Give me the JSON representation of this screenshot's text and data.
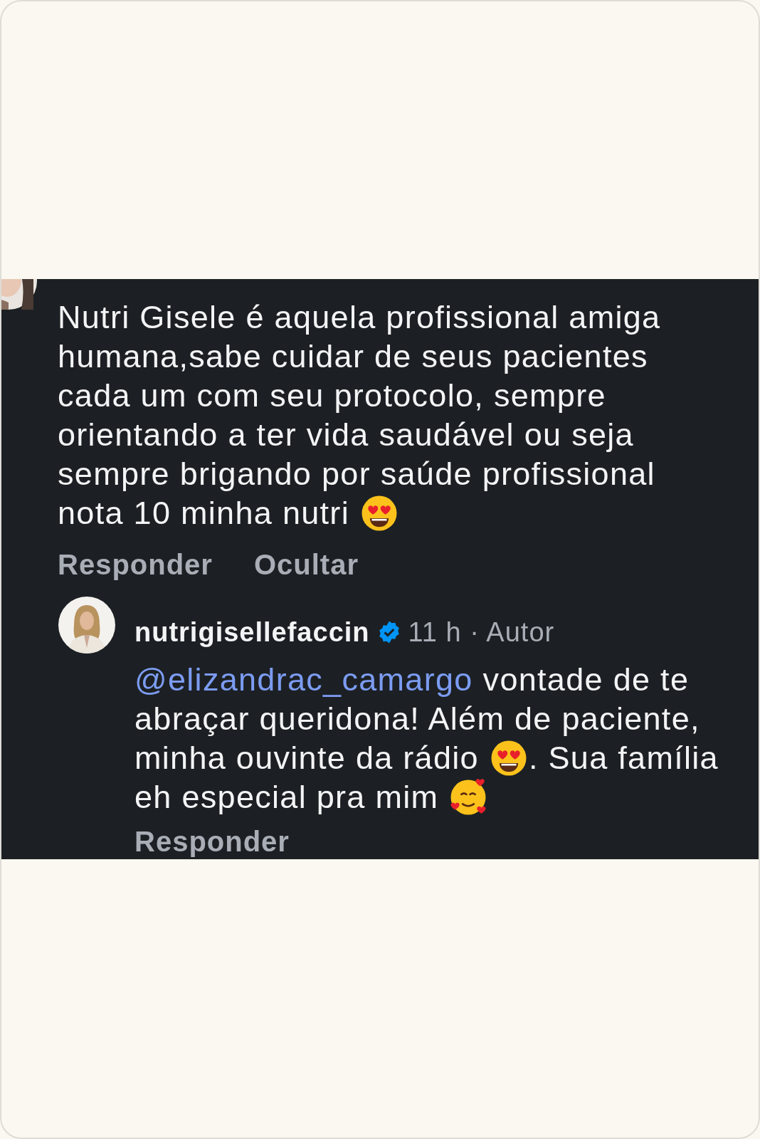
{
  "comment": {
    "avatar": {
      "kind": "picture"
    },
    "lines": [
      [
        {
          "kind": "text",
          "text": "Nutri Gisele é aquela profissional amiga"
        }
      ],
      [
        {
          "kind": "text",
          "text": "humana,sabe cuidar de seus pacientes"
        }
      ],
      [
        {
          "kind": "text",
          "text": "cada um com seu protocolo, sempre"
        }
      ],
      [
        {
          "kind": "text",
          "text": "orientando a ter vida saudável ou seja"
        }
      ],
      [
        {
          "kind": "text",
          "text": "sempre brigando por saúde profissional"
        }
      ],
      [
        {
          "kind": "text",
          "text": "nota 10 minha nutri"
        },
        {
          "kind": "heart_eyes"
        }
      ]
    ],
    "actions": [
      "Responder",
      "Ocultar"
    ]
  },
  "reply": {
    "avatar": {
      "kind": "picture"
    },
    "username": "nutrigisellefaccin",
    "verified": true,
    "time": "11 h · Autor",
    "lines": [
      [
        {
          "kind": "mention",
          "text": "@elizandrac_camargo"
        },
        {
          "kind": "text",
          "text": "vontade de te"
        }
      ],
      [
        {
          "kind": "text",
          "text": "abraçar queridona! Além de paciente,"
        }
      ],
      [
        {
          "kind": "text",
          "text": "minha ouvinte da rádio"
        },
        {
          "kind": "heart_eyes"
        },
        {
          "kind": "text",
          "text": ". Sua família"
        }
      ],
      [
        {
          "kind": "text",
          "text": "eh especial pra mim"
        },
        {
          "kind": "hearts_smile"
        }
      ]
    ],
    "actions": [
      "Responder"
    ]
  }
}
